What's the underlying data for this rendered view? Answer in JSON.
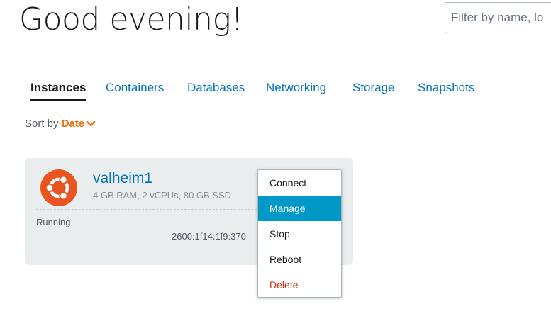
{
  "header": {
    "greeting": "Good evening!",
    "filter_placeholder": "Filter by name, lo"
  },
  "tabs": [
    {
      "label": "Instances",
      "active": true
    },
    {
      "label": "Containers",
      "active": false
    },
    {
      "label": "Databases",
      "active": false
    },
    {
      "label": "Networking",
      "active": false
    },
    {
      "label": "Storage",
      "active": false
    },
    {
      "label": "Snapshots",
      "active": false
    }
  ],
  "sort": {
    "label": "Sort by",
    "value": "Date"
  },
  "instance": {
    "os_icon": "ubuntu-logo-icon",
    "name": "valheim1",
    "specs": "4 GB RAM, 2 vCPUs, 80 GB SSD",
    "status": "Running",
    "ip": "2600:1f14:1f9:370"
  },
  "menu": {
    "items": [
      {
        "label": "Connect"
      },
      {
        "label": "Manage",
        "highlighted": true
      },
      {
        "label": "Stop"
      },
      {
        "label": "Reboot"
      },
      {
        "label": "Delete",
        "danger": true
      }
    ]
  },
  "colors": {
    "link": "#0073bb",
    "accent_orange": "#ec7211",
    "ubuntu_orange": "#e95420",
    "menu_highlight": "#0099c7",
    "danger": "#d13212",
    "card_bg": "#eaeded"
  }
}
